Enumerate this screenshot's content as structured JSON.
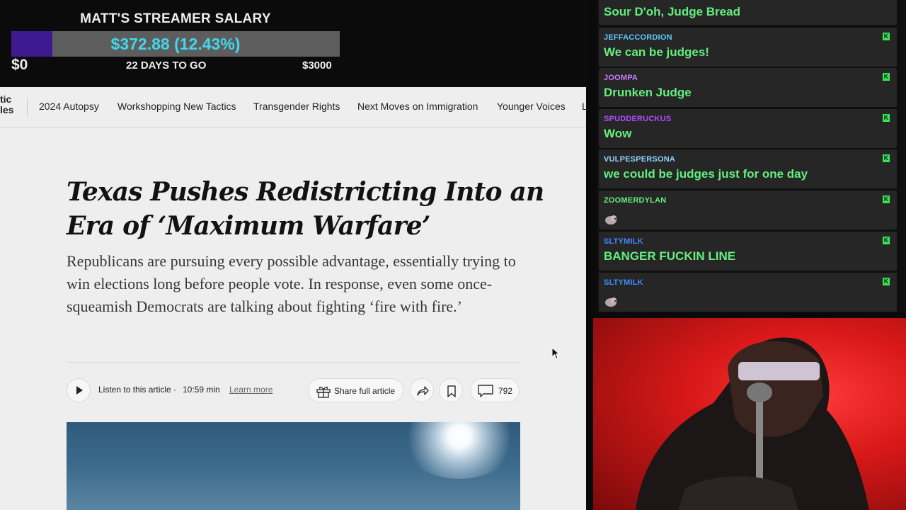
{
  "salary": {
    "title": "MATT'S STREAMER SALARY",
    "amount": "$372.88 (12.43%)",
    "progress": 0.1243,
    "min": "$0",
    "days_left": "22 DAYS TO GO",
    "max": "$3000",
    "fill_color": "#3d1a8f",
    "amount_color": "#41d7ee"
  },
  "nav": {
    "partial_label": "tic\nles",
    "partial_right": "L",
    "items": [
      "2024 Autopsy",
      "Workshopping New Tactics",
      "Transgender Rights",
      "Next Moves on Immigration",
      "Younger Voices"
    ]
  },
  "article": {
    "headline": "Texas Pushes Redistricting Into an Era of ‘Maximum Warfare’",
    "summary": "Republicans are pursuing every possible advantage, essentially trying to win elections long before people vote. In response, even some once-squeamish Democrats are talking about fighting ‘fire with fire.’",
    "listen_label": "Listen to this article ·",
    "listen_duration": "10:59 min",
    "learn_more": "Learn more",
    "share_label": "Share full article",
    "comment_count": "792"
  },
  "chat": {
    "text_color": "#63ef7e",
    "messages": [
      {
        "user": "",
        "text": "Sour D'oh, Judge Bread",
        "user_color": "#8fd3ff"
      },
      {
        "user": "JEFFACCORDION",
        "text": "We can be judges!",
        "user_color": "#5ec9ff"
      },
      {
        "user": "JOOMPA",
        "text": "Drunken Judge",
        "user_color": "#c77dff"
      },
      {
        "user": "SPUDDERUCKUS",
        "text": "Wow",
        "user_color": "#b04dff"
      },
      {
        "user": "VULPESPERSONA",
        "text": "we could be judges just for one day",
        "user_color": "#8fd3ff"
      },
      {
        "user": "ZOOMERDYLAN",
        "text": "",
        "user_color": "#63ef7e"
      },
      {
        "user": "SLTYMILK",
        "text": "BANGER FUCKIN LINE",
        "user_color": "#3d8bff"
      },
      {
        "user": "SLTYMILK",
        "text": "",
        "user_color": "#3d8bff"
      }
    ],
    "badge": "K"
  },
  "icons": {
    "play": "play-icon",
    "gift": "gift-icon",
    "share": "share-arrow-icon",
    "bookmark": "bookmark-icon",
    "comment": "comment-icon",
    "emote": "pig-emote-icon",
    "cursor": "mouse-pointer-icon"
  }
}
